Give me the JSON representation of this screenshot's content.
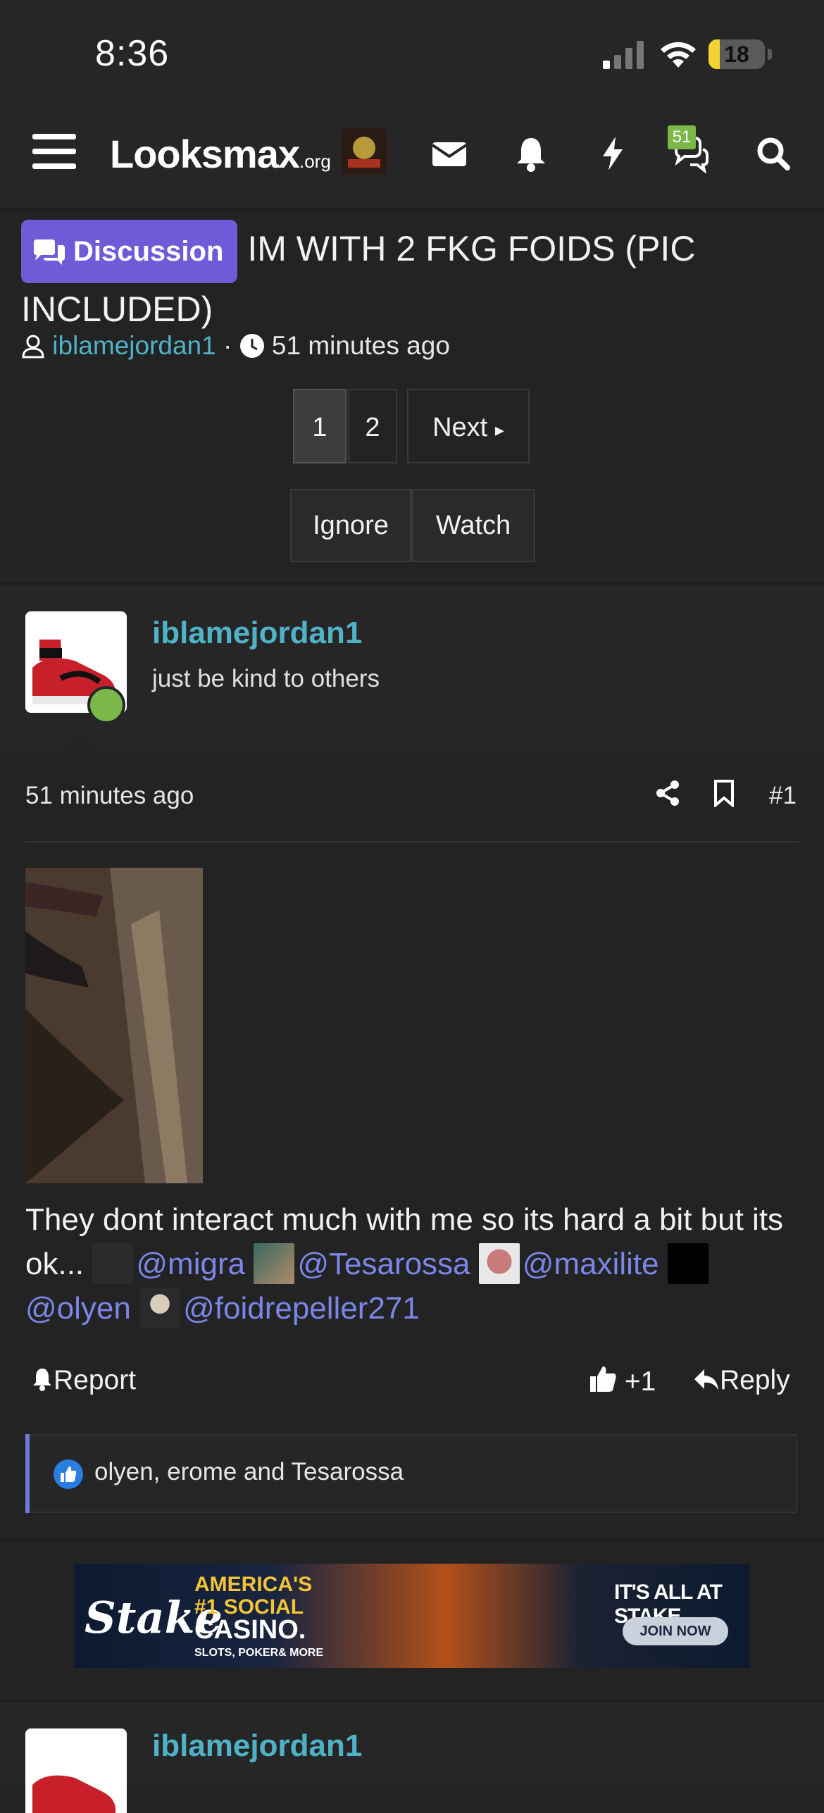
{
  "status_bar": {
    "time": "8:36",
    "battery": "18"
  },
  "nav": {
    "logo_main": "Looksmax",
    "logo_suffix": ".org",
    "chat_badge": "51"
  },
  "thread": {
    "prefix": "Discussion",
    "title": "IM WITH 2 FKG FOIDS (PIC INCLUDED)",
    "author": "iblamejordan1",
    "meta_separator": "·",
    "time": "51 minutes ago"
  },
  "pagination": {
    "pages": [
      "1",
      "2"
    ],
    "current": "1",
    "next": "Next"
  },
  "thread_actions": {
    "ignore": "Ignore",
    "watch": "Watch"
  },
  "post": {
    "username": "iblamejordan1",
    "user_title": "just be kind to others",
    "time": "51 minutes ago",
    "number": "#1",
    "body_text": "They dont interact much with me so its hard a bit but its ok...",
    "mentions": [
      "@migra",
      "@Tesarossa",
      "@maxilite",
      "@olyen",
      "@foidrepeller271"
    ],
    "report": "Report",
    "like_count": "+1",
    "reply": "Reply",
    "reactions_text": "olyen, erome and Tesarossa"
  },
  "ad": {
    "brand": "Stake",
    "line1": "AMERICA'S",
    "line2": "#1 SOCIAL",
    "line3": "CASINO.",
    "line4": "SLOTS, POKER& MORE",
    "tagline": "IT'S ALL AT STAKE",
    "cta": "JOIN NOW"
  },
  "next_post": {
    "username": "iblamejordan1"
  },
  "colors": {
    "accent_link": "#4fb3c8",
    "mention": "#7b86e8",
    "prefix_bg": "#6e5bd8",
    "online": "#7ab84a"
  }
}
